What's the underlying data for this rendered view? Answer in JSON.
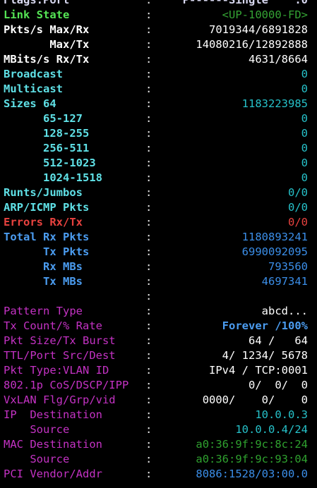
{
  "terminal": {
    "header_label": "Flags:Port",
    "header_value": "P------Single    :0",
    "separator": ":",
    "rows": [
      {
        "key": "link_state",
        "label": "Link State",
        "value": "<UP-10000-FD>"
      },
      {
        "key": "pkts_max_rx",
        "label": "Pkts/s Max/Rx",
        "value": "7019344/6891828"
      },
      {
        "key": "pkts_max_tx",
        "label": "       Max/Tx",
        "value": "14080216/12892888"
      },
      {
        "key": "mbits_rx_tx",
        "label": "MBits/s Rx/Tx",
        "value": "4631/8664"
      },
      {
        "key": "broadcast",
        "label": "Broadcast",
        "value": "0"
      },
      {
        "key": "multicast",
        "label": "Multicast",
        "value": "0"
      },
      {
        "key": "sizes_64",
        "label": "Sizes 64",
        "value": "1183223985"
      },
      {
        "key": "sizes_65_127",
        "label": "      65-127",
        "value": "0"
      },
      {
        "key": "sizes_128_255",
        "label": "      128-255",
        "value": "0"
      },
      {
        "key": "sizes_256_511",
        "label": "      256-511",
        "value": "0"
      },
      {
        "key": "sizes_512_1023",
        "label": "      512-1023",
        "value": "0"
      },
      {
        "key": "sizes_1024_1518",
        "label": "      1024-1518",
        "value": "0"
      },
      {
        "key": "runts_jumbos",
        "label": "Runts/Jumbos",
        "value": "0/0"
      },
      {
        "key": "arp_icmp",
        "label": "ARP/ICMP Pkts",
        "value": "0/0"
      },
      {
        "key": "errors",
        "label": "Errors Rx/Tx",
        "value": "0/0"
      },
      {
        "key": "total_rx_pkts",
        "label": "Total Rx Pkts",
        "value": "1180893241"
      },
      {
        "key": "tx_pkts",
        "label": "      Tx Pkts",
        "value": "6990092095"
      },
      {
        "key": "rx_mbs",
        "label": "      Rx MBs",
        "value": "793560"
      },
      {
        "key": "tx_mbs",
        "label": "      Tx MBs",
        "value": "4697341"
      },
      {
        "key": "blank",
        "label": "",
        "value": ""
      },
      {
        "key": "pattern_type",
        "label": "Pattern Type",
        "value": "abcd..."
      },
      {
        "key": "tx_count_rate",
        "label": "Tx Count/% Rate",
        "value": "Forever /100%"
      },
      {
        "key": "pkt_size_burst",
        "label": "Pkt Size/Tx Burst",
        "value": "64 /   64"
      },
      {
        "key": "ttl_port",
        "label": "TTL/Port Src/Dest",
        "value": "4/ 1234/ 5678"
      },
      {
        "key": "pkt_type_vlan",
        "label": "Pkt Type:VLAN ID",
        "value": "IPv4 / TCP:0001"
      },
      {
        "key": "cos_dscp_ipp",
        "label": "802.1p CoS/DSCP/IPP",
        "value": "0/  0/  0"
      },
      {
        "key": "vxlan",
        "label": "VxLAN Flg/Grp/vid",
        "value": "0000/    0/    0"
      },
      {
        "key": "ip_destination",
        "label": "IP  Destination",
        "value": "10.0.0.3"
      },
      {
        "key": "ip_source",
        "label": "    Source",
        "value": "10.0.0.4/24"
      },
      {
        "key": "mac_destination",
        "label": "MAC Destination",
        "value": "a0:36:9f:9c:8c:24"
      },
      {
        "key": "mac_source",
        "label": "    Source",
        "value": "a0:36:9f:9c:93:04"
      },
      {
        "key": "pci_vendor",
        "label": "PCI Vendor/Addr",
        "value": "8086:1528/03:00.0"
      }
    ]
  },
  "colors": {
    "background": "#000000",
    "white": "#ffffff",
    "cyan": "#5fe0e6",
    "red": "#e8423f",
    "green": "#55e655",
    "blue": "#3b8ee8",
    "magenta": "#c432c4",
    "teal": "#26c1c9",
    "dark_green": "#2fa12f"
  }
}
